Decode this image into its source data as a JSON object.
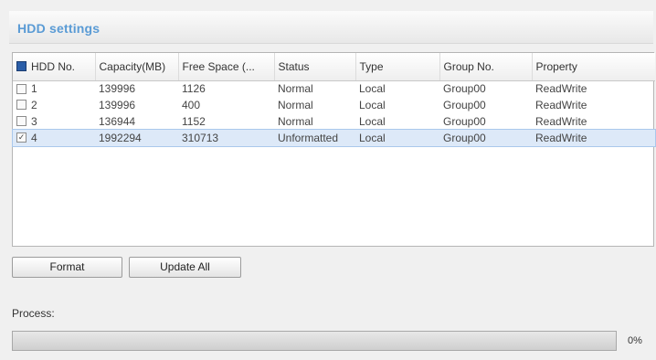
{
  "panel": {
    "title": "HDD settings"
  },
  "table": {
    "columns": [
      "HDD No.",
      "Capacity(MB)",
      "Free Space (...",
      "Status",
      "Type",
      "Group No.",
      "Property"
    ],
    "rows": [
      {
        "checked": false,
        "hdd_no": "1",
        "capacity": "139996",
        "free_space": "1126",
        "status": "Normal",
        "type": "Local",
        "group": "Group00",
        "property": "ReadWrite"
      },
      {
        "checked": false,
        "hdd_no": "2",
        "capacity": "139996",
        "free_space": "400",
        "status": "Normal",
        "type": "Local",
        "group": "Group00",
        "property": "ReadWrite"
      },
      {
        "checked": false,
        "hdd_no": "3",
        "capacity": "136944",
        "free_space": "1152",
        "status": "Normal",
        "type": "Local",
        "group": "Group00",
        "property": "ReadWrite"
      },
      {
        "checked": true,
        "hdd_no": "4",
        "capacity": "1992294",
        "free_space": "310713",
        "status": "Unformatted",
        "type": "Local",
        "group": "Group00",
        "property": "ReadWrite"
      }
    ]
  },
  "buttons": {
    "format": "Format",
    "update_all": "Update All"
  },
  "process": {
    "label": "Process:",
    "percent_text": "0%",
    "fraction": 0
  }
}
